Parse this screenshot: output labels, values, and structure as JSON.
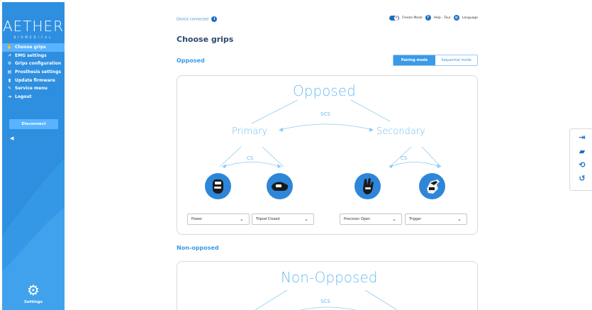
{
  "sidebar": {
    "brand": "AETHER",
    "brand_sub": "BIOMEDICAL",
    "items": [
      {
        "label": "Choose grips",
        "icon": "hand-icon",
        "glyph": "✋"
      },
      {
        "label": "EMG settings",
        "icon": "chart-icon",
        "glyph": "📈"
      },
      {
        "label": "Grips configuration",
        "icon": "cog-icon",
        "glyph": "⚙"
      },
      {
        "label": "Prosthesis settings",
        "icon": "clipboard-icon",
        "glyph": "▤"
      },
      {
        "label": "Update firmware",
        "icon": "chip-icon",
        "glyph": "▮"
      },
      {
        "label": "Service menu",
        "icon": "wrench-icon",
        "glyph": "🔧"
      },
      {
        "label": "Logout",
        "icon": "logout-icon",
        "glyph": "⇥"
      }
    ],
    "disconnect_label": "Disconnect",
    "settings_label": "Settings"
  },
  "topbar": {
    "device_status": "Device connected",
    "freeze_mode": "Freeze Mode",
    "help_tour": "Help - Tour",
    "language": "Language"
  },
  "page": {
    "title": "Choose grips",
    "section_opposed": "Opposed",
    "section_nonopposed": "Non-opposed",
    "mode_pairing": "Pairing mode",
    "mode_sequential": "Sequential mode"
  },
  "opposed": {
    "root": "Opposed",
    "scs": "SCS",
    "primary": "Primary",
    "secondary": "Secondary",
    "cs_left": "CS",
    "cs_right": "CS",
    "grips": [
      "Power",
      "Tripod Closed",
      "Precision Open",
      "Trigger"
    ]
  },
  "nonopposed": {
    "root": "Non-Opposed",
    "scs": "SCS"
  },
  "colors": {
    "sidebar": "#2e8fe0",
    "accent": "#3a9ae6",
    "diagram": "#6bbcf0",
    "title": "#2b4a6f"
  }
}
